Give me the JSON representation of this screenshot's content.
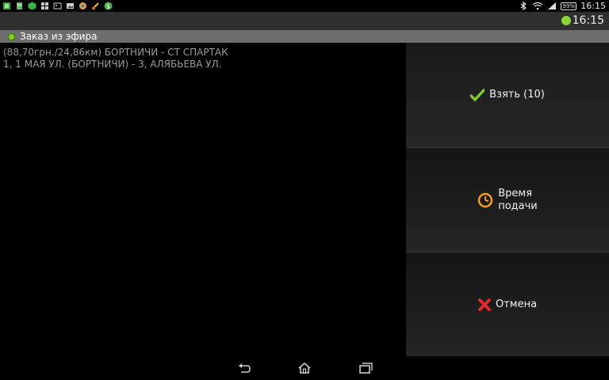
{
  "status_bar": {
    "battery": "99%",
    "time": "16:15"
  },
  "action_bar": {
    "clock": "16:15"
  },
  "title_bar": {
    "title": "Заказ из эфира"
  },
  "order": {
    "line1": "(88,70грн./24,86км) БОРТНИЧИ - СТ СПАРТАК",
    "line2": "1, 1 МАЯ УЛ. (БОРТНИЧИ) - 3, АЛЯБЬЕВА УЛ."
  },
  "buttons": {
    "take": {
      "label": "Взять (10)",
      "icon": "checkmark-icon"
    },
    "time": {
      "label_line1": "Время",
      "label_line2": "подачи",
      "icon": "clock-icon"
    },
    "cancel": {
      "label": "Отмена",
      "icon": "cross-icon"
    }
  },
  "colors": {
    "check_green": "#7ecb2a",
    "clock_orange": "#f0a020",
    "cancel_red": "#e02a2a",
    "title_bar_bg": "#6e6e6e"
  }
}
